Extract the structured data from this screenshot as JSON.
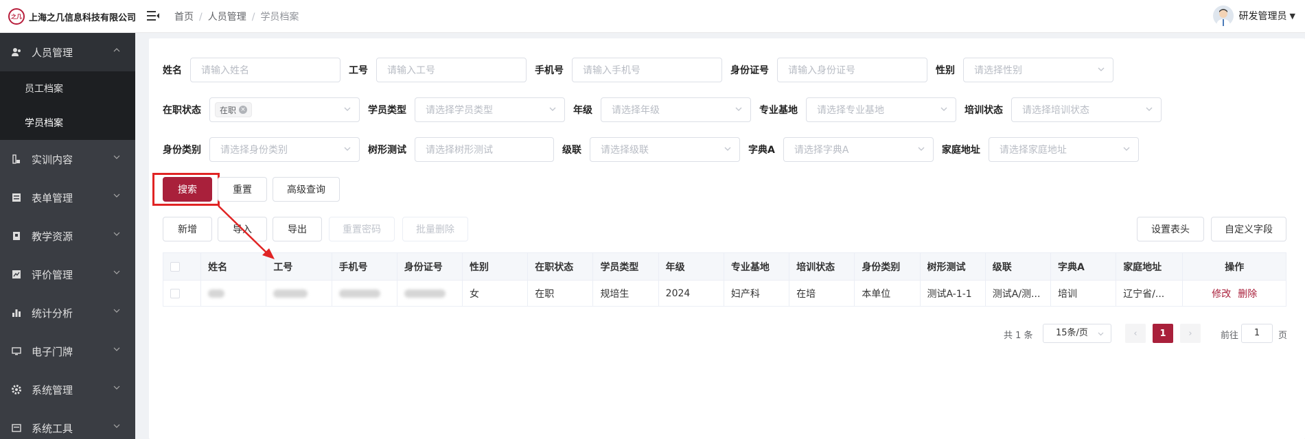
{
  "header": {
    "company": "上海之几信息科技有限公司",
    "logo_text": "之几",
    "breadcrumb": [
      "首页",
      "人员管理",
      "学员档案"
    ],
    "breadcrumb_sep": "/",
    "user_name": "研发管理员"
  },
  "sidebar": {
    "items": [
      {
        "label": "人员管理",
        "icon": "users-icon",
        "expanded": true
      },
      {
        "label": "实训内容",
        "icon": "training-icon"
      },
      {
        "label": "表单管理",
        "icon": "form-icon"
      },
      {
        "label": "教学资源",
        "icon": "resource-icon"
      },
      {
        "label": "评价管理",
        "icon": "evaluation-icon"
      },
      {
        "label": "统计分析",
        "icon": "chart-icon"
      },
      {
        "label": "电子门牌",
        "icon": "monitor-icon"
      },
      {
        "label": "系统管理",
        "icon": "gear-icon"
      },
      {
        "label": "系统工具",
        "icon": "tools-icon"
      }
    ],
    "sub_items": [
      "员工档案",
      "学员档案"
    ]
  },
  "filters": {
    "name": {
      "label": "姓名",
      "placeholder": "请输入姓名"
    },
    "job_no": {
      "label": "工号",
      "placeholder": "请输入工号"
    },
    "phone": {
      "label": "手机号",
      "placeholder": "请输入手机号"
    },
    "id_card": {
      "label": "身份证号",
      "placeholder": "请输入身份证号"
    },
    "gender": {
      "label": "性别",
      "placeholder": "请选择性别"
    },
    "status": {
      "label": "在职状态",
      "tag": "在职"
    },
    "student_type": {
      "label": "学员类型",
      "placeholder": "请选择学员类型"
    },
    "grade": {
      "label": "年级",
      "placeholder": "请选择年级"
    },
    "base": {
      "label": "专业基地",
      "placeholder": "请选择专业基地"
    },
    "train_status": {
      "label": "培训状态",
      "placeholder": "请选择培训状态"
    },
    "identity": {
      "label": "身份类别",
      "placeholder": "请选择身份类别"
    },
    "tree_test": {
      "label": "树形测试",
      "placeholder": "请选择树形测试"
    },
    "cascade": {
      "label": "级联",
      "placeholder": "请选择级联"
    },
    "dict_a": {
      "label": "字典A",
      "placeholder": "请选择字典A"
    },
    "address": {
      "label": "家庭地址",
      "placeholder": "请选择家庭地址"
    }
  },
  "actions": {
    "search": "搜索",
    "reset": "重置",
    "advanced": "高级查询",
    "add": "新增",
    "import": "导入",
    "export": "导出",
    "reset_password": "重置密码",
    "batch_delete": "批量删除",
    "set_header": "设置表头",
    "custom_field": "自定义字段"
  },
  "table": {
    "columns": [
      "姓名",
      "工号",
      "手机号",
      "身份证号",
      "性别",
      "在职状态",
      "学员类型",
      "年级",
      "专业基地",
      "培训状态",
      "身份类别",
      "树形测试",
      "级联",
      "字典A",
      "家庭地址",
      "操作"
    ],
    "rows": [
      {
        "gender": "女",
        "status": "在职",
        "type": "规培生",
        "grade": "2024",
        "base": "妇产科",
        "train": "在培",
        "identity": "本单位",
        "tree": "测试A-1-1",
        "cascade": "测试A/测...",
        "dict": "培训",
        "address": "辽宁省/...",
        "edit": "修改",
        "delete": "删除"
      }
    ]
  },
  "pagination": {
    "total": "共 1 条",
    "page_size": "15条/页",
    "current": "1",
    "goto_label": "前往",
    "goto_value": "1",
    "page_suffix": "页",
    "prev": "‹",
    "next": "›"
  },
  "colors": {
    "primary": "#a9203b",
    "highlight": "#e02424",
    "sidebar": "#3a3d43"
  }
}
